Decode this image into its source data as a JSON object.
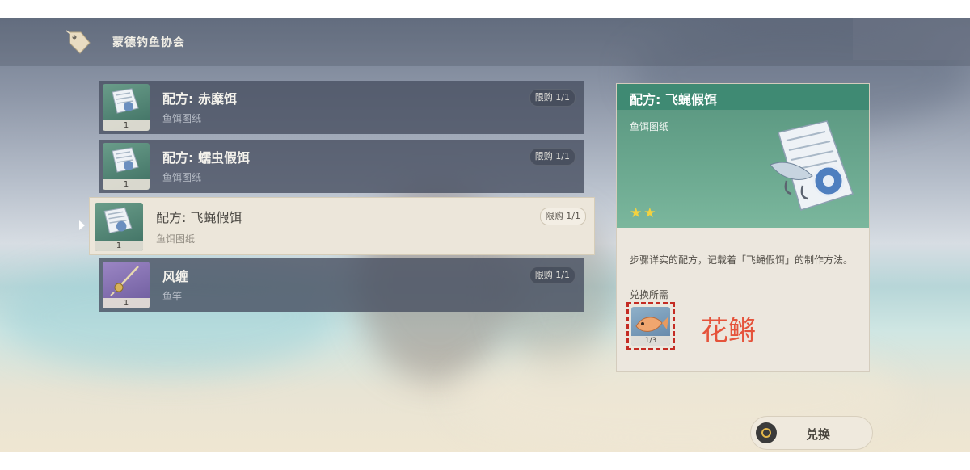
{
  "header": {
    "shop_title": "蒙德钓鱼协会"
  },
  "items": [
    {
      "name": "配方: 赤糜饵",
      "type": "鱼饵图纸",
      "limit": "限购 1/1",
      "count": "1",
      "color": "green",
      "selected": false
    },
    {
      "name": "配方: 蠕虫假饵",
      "type": "鱼饵图纸",
      "limit": "限购 1/1",
      "count": "1",
      "color": "green",
      "selected": false
    },
    {
      "name": "配方: 飞蝇假饵",
      "type": "鱼饵图纸",
      "limit": "限购 1/1",
      "count": "1",
      "color": "green",
      "selected": true
    },
    {
      "name": "风缠",
      "type": "鱼竿",
      "limit": "限购 1/1",
      "count": "1",
      "color": "purple",
      "selected": false
    }
  ],
  "detail": {
    "title": "配方: 飞蝇假饵",
    "type": "鱼饵图纸",
    "stars": "★★",
    "description": "步骤详实的配方，记载着「飞蝇假饵」的制作方法。",
    "need_label": "兑换所需",
    "need_count": "1/3"
  },
  "annotation": {
    "text": "花鳉",
    "color": "#e5533b"
  },
  "footer": {
    "exchange_label": "兑换"
  },
  "colors": {
    "accent_green": "#3f8a73",
    "star": "#f3d23f",
    "highlight_dash": "#c42c24"
  }
}
